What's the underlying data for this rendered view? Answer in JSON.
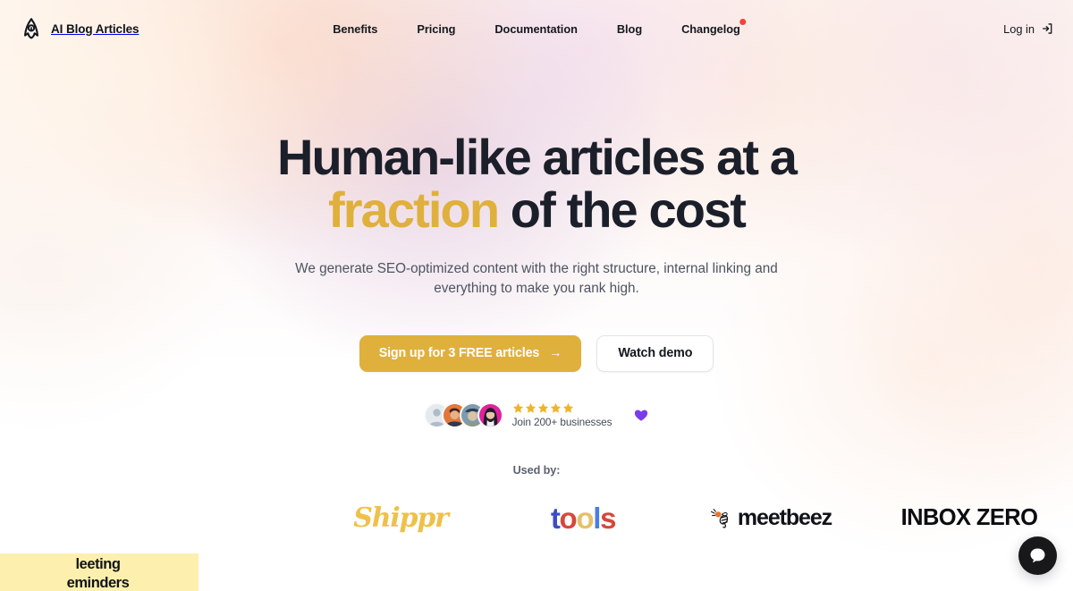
{
  "header": {
    "brand": {
      "name": "AI Blog Articles",
      "icon": "rocket-logo-icon"
    },
    "nav": [
      {
        "label": "Benefits",
        "badge": false
      },
      {
        "label": "Pricing",
        "badge": false
      },
      {
        "label": "Documentation",
        "badge": false
      },
      {
        "label": "Blog",
        "badge": false
      },
      {
        "label": "Changelog",
        "badge": true
      }
    ],
    "login": {
      "label": "Log in",
      "icon": "login-arrow-icon"
    }
  },
  "hero": {
    "title_line1": "Human-like articles at a",
    "title_accent": "fraction",
    "title_rest": " of the cost",
    "subtitle": "We generate SEO-optimized content with the right structure, internal linking and everything to make you rank high.",
    "primary_cta": "Sign up for 3 FREE articles",
    "primary_cta_arrow": "→",
    "secondary_cta": "Watch demo"
  },
  "social_proof": {
    "rating_count": 5,
    "label": "Join 200+ businesses",
    "heart_icon": "purple-heart-icon",
    "avatars": [
      {
        "name": "avatar-placeholder",
        "bg": "#dfe4ea"
      },
      {
        "name": "avatar-man",
        "bg": "#e2773a"
      },
      {
        "name": "avatar-person-hat",
        "bg": "#6d8fa8"
      },
      {
        "name": "avatar-woman",
        "bg": "#e0219e"
      }
    ]
  },
  "used_by": {
    "label": "Used by:",
    "logos": [
      {
        "name": "fleeting-reminders",
        "line1": "leeting",
        "line2": "eminders",
        "bg": "#fdf0ae"
      },
      {
        "name": "shippr",
        "text": "Shippr",
        "color": "#efc04a"
      },
      {
        "name": "tools",
        "letters": [
          {
            "ch": "t",
            "color": "#3c4ec2"
          },
          {
            "ch": "o",
            "color": "#d6483b"
          },
          {
            "ch": "o",
            "color": "#e6c069"
          },
          {
            "ch": "l",
            "color": "#4a7fe0"
          },
          {
            "ch": "s",
            "color": "#d6483b"
          }
        ]
      },
      {
        "name": "meetbeez",
        "text": "meetbeez",
        "color": "#101319"
      },
      {
        "name": "inbox-zero",
        "text": "INBOX ZERO",
        "color": "#0b0d12"
      }
    ]
  },
  "chat": {
    "icon": "chat-bubble-icon"
  },
  "colors": {
    "accent_gold": "#e0b03c",
    "text_dark": "#1b1f2a",
    "text_muted": "#4d5461",
    "badge_red": "#f04438",
    "heart_purple": "#7c3aed"
  }
}
